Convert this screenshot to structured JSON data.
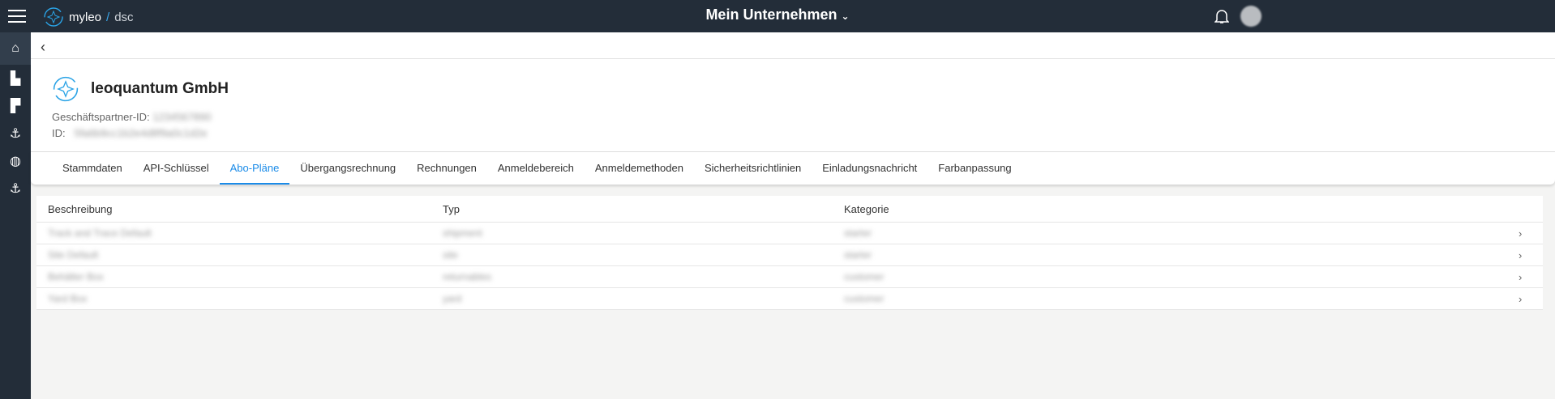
{
  "topbar": {
    "brand": "myleo",
    "slash": "/",
    "product": "dsc",
    "title": "Mein Unternehmen"
  },
  "company": {
    "name": "leoquantum GmbH",
    "partner_label": "Geschäftspartner-ID:",
    "partner_value": "1234567890",
    "id_label": "ID:",
    "id_value": "5fa6b9cc1b2e4d8f9a0c1d2e"
  },
  "tabs": [
    "Stammdaten",
    "API-Schlüssel",
    "Abo-Pläne",
    "Übergangsrechnung",
    "Rechnungen",
    "Anmeldebereich",
    "Anmeldemethoden",
    "Sicherheitsrichtlinien",
    "Einladungsnachricht",
    "Farbanpassung"
  ],
  "active_tab": "Abo-Pläne",
  "table": {
    "headers": [
      "Beschreibung",
      "Typ",
      "Kategorie"
    ],
    "rows": [
      [
        "Track and Trace Default",
        "shipment",
        "starter"
      ],
      [
        "Site Default",
        "site",
        "starter"
      ],
      [
        "Behälter Box",
        "returnables",
        "customer"
      ],
      [
        "Yard Box",
        "yard",
        "customer"
      ]
    ]
  },
  "colors": {
    "accent": "#1a8be8",
    "sidebar": "#232d39"
  }
}
